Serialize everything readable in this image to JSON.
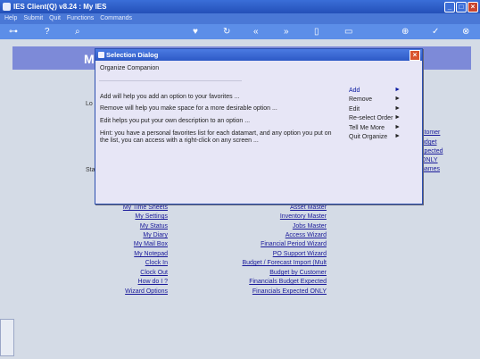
{
  "app": {
    "title": "IES Client(Q) v8.24 : My IES"
  },
  "menu": [
    "Help",
    "Submit",
    "Quit",
    "Functions",
    "Commands"
  ],
  "toolbar_icons": [
    "key-icon",
    "help-icon",
    "search-icon",
    "heart-icon",
    "refresh-icon",
    "rewind-icon",
    "forward-icon",
    "bookmark-icon",
    "print-icon",
    "add-icon",
    "check-icon",
    "close-icon"
  ],
  "colors": {
    "titlebar": "#2d59c6",
    "menubar": "#4a78d6",
    "toolbar": "#5c8ee8",
    "band": "#7d8ad8",
    "dialog_bg": "#e7e6f6",
    "link": "#1a1a9a"
  },
  "background": {
    "band_letter": "M",
    "side_labels": [
      "Lo",
      "Sta"
    ],
    "right_partial": [
      "stomer",
      "udget",
      "xpected",
      "ONLY",
      "names"
    ],
    "left_links": [
      "My Time Sheets",
      "My Settings",
      "My Status",
      "My Diary",
      "My Mail Box",
      "My Notepad",
      "Clock In",
      "Clock Out",
      "How do I ?",
      "Wizard Options"
    ],
    "right_links": [
      "Asset Master",
      "Inventory Master",
      "Jobs Master",
      "Access Wizard",
      "Financial Period Wizard",
      "PO Support Wizard",
      "Budget / Forecast Import (Mult",
      "Budget by Customer",
      "Financials Budget Expected",
      "Financials Expected ONLY"
    ]
  },
  "dialog": {
    "title": "Selection Dialog",
    "subtitle": "Organize Companion",
    "lines": [
      "Add will help you add an option to your favorites ...",
      "Remove will help you make space for a more desirable option ...",
      "Edit helps you put your own description to an option ...",
      "Hint: you have a personal favorites list for each datamart, and any option you put on the list, you can access with a right-click on any screen ..."
    ],
    "options": [
      "Add",
      "Remove",
      "Edit",
      "Re-select Order",
      "Tell Me More",
      "Quit Organize"
    ]
  }
}
